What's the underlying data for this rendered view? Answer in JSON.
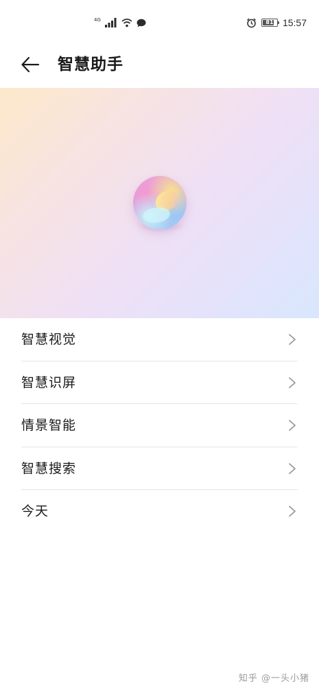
{
  "status_bar": {
    "network_label": "4G",
    "battery_level": "81",
    "time": "15:57",
    "icons": {
      "signal": "cellular-signal-icon",
      "wifi": "wifi-icon",
      "message": "chat-bubble-icon",
      "alarm": "alarm-clock-icon",
      "battery": "battery-icon"
    }
  },
  "header": {
    "back_icon": "arrow-left-icon",
    "title": "智慧助手"
  },
  "hero": {
    "logo_icon": "assistant-orb-icon",
    "colors": {
      "gradient_start": "#fde9c9",
      "gradient_mid": "#efe0f5",
      "gradient_end": "#d8e7fd"
    }
  },
  "menu": {
    "items": [
      {
        "label": "智慧视觉",
        "icon": "chevron-right-icon"
      },
      {
        "label": "智慧识屏",
        "icon": "chevron-right-icon"
      },
      {
        "label": "情景智能",
        "icon": "chevron-right-icon"
      },
      {
        "label": "智慧搜索",
        "icon": "chevron-right-icon"
      },
      {
        "label": "今天",
        "icon": "chevron-right-icon"
      }
    ]
  },
  "watermark": {
    "text": "知乎 @一头小猪"
  }
}
